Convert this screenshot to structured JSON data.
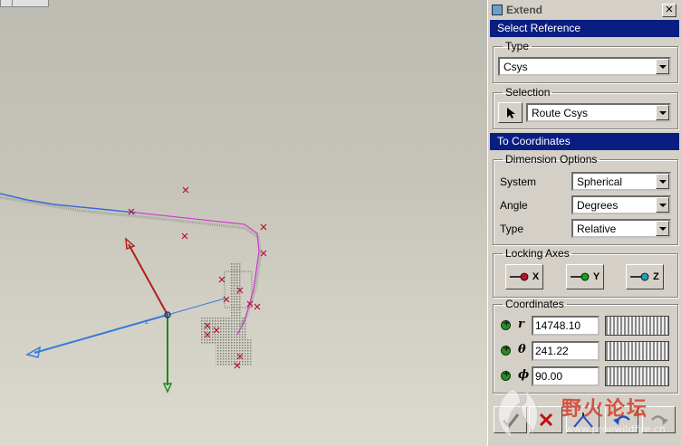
{
  "dialog": {
    "title": "Extend",
    "close_label": "✕",
    "select_reference_header": "Select Reference",
    "type_group": {
      "legend": "Type",
      "value": "Csys"
    },
    "selection_group": {
      "legend": "Selection",
      "value": "Route Csys"
    },
    "to_coordinates_header": "To Coordinates",
    "dimension_options": {
      "legend": "Dimension Options",
      "rows": [
        {
          "label": "System",
          "value": "Spherical"
        },
        {
          "label": "Angle",
          "value": "Degrees"
        },
        {
          "label": "Type",
          "value": "Relative"
        }
      ]
    },
    "locking_axes": {
      "legend": "Locking Axes",
      "buttons": [
        {
          "label": "X",
          "color": "#c0102a"
        },
        {
          "label": "Y",
          "color": "#1aa01a"
        },
        {
          "label": "Z",
          "color": "#20a0b0"
        }
      ]
    },
    "coordinates": {
      "legend": "Coordinates",
      "rows": [
        {
          "symbol": "r",
          "value": "14748.10"
        },
        {
          "symbol": "θ",
          "value": "241.22"
        },
        {
          "symbol": "ϕ",
          "value": "90.00"
        }
      ]
    },
    "bottom_buttons": [
      "ok-check-icon",
      "cancel-x-icon",
      "preview-icon",
      "undo-icon",
      "redo-icon"
    ]
  },
  "watermark": {
    "text": "野火论坛",
    "url": "www.proewildfire.cn"
  },
  "colors": {
    "header_blue": "#0a1e82",
    "route_magenta": "#d040d0",
    "csys_blue": "#3a7ad8",
    "csys_green": "#1a8a1a",
    "csys_red": "#b02020"
  }
}
